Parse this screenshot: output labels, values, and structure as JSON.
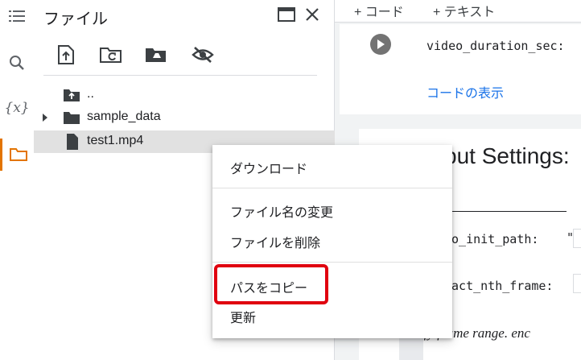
{
  "files_panel": {
    "title": "ファイル",
    "tree": [
      {
        "label": "..",
        "type": "parent"
      },
      {
        "label": "sample_data",
        "type": "folder"
      },
      {
        "label": "test1.mp4",
        "type": "file"
      }
    ]
  },
  "notebook": {
    "toolbar": {
      "code_label": "+ コード",
      "text_label": "+ テキスト"
    },
    "cell1": {
      "code": "video_duration_sec:",
      "show_code": "コードの表示"
    },
    "cell2": {
      "title_fragment": "put Settings:",
      "field1": "eo_init_path:",
      "quote": "\"",
      "field2": "ract_nth_frame:",
      "italic": "ify frame range. enc"
    }
  },
  "context_menu": {
    "items": [
      {
        "label": "ダウンロード"
      },
      {
        "label": "ファイル名の変更"
      },
      {
        "label": "ファイルを削除"
      },
      {
        "label": "パスをコピー",
        "highlighted": true
      },
      {
        "label": "更新"
      }
    ]
  },
  "colors": {
    "accent": "#e37400",
    "link": "#1a73e8",
    "highlight_border": "#e0000f",
    "selected_row": "#e1e1e1"
  }
}
